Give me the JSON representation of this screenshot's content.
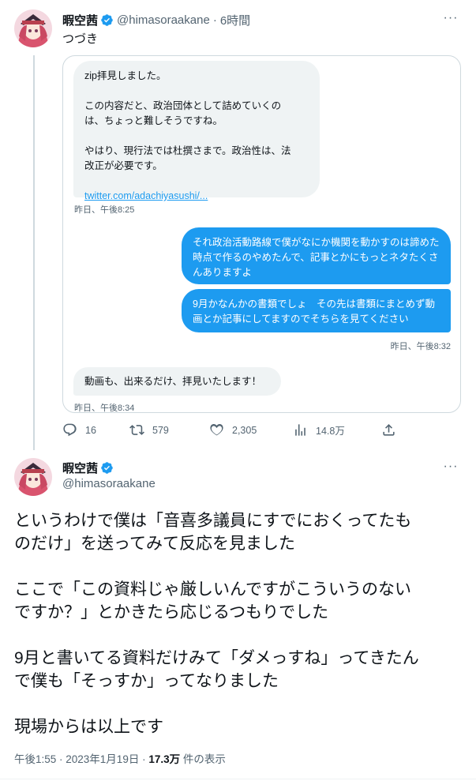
{
  "tweet1": {
    "name": "暇空茜",
    "handle": "@himasoraakane",
    "separator": "·",
    "time": "6時間",
    "text": "つづき",
    "more": "···",
    "dm": {
      "msg1_lines": [
        "zip拝見しました。",
        "",
        "この内容だと、政治団体として詰めていくの",
        "は、ちょっと難しそうですね。",
        "",
        "やはり、現行法では杜撰さまで。政治性は、法",
        "改正が必要です。",
        ""
      ],
      "msg1_link": "twitter.com/adachiyasushi/...",
      "ts1": "昨日、午後8:25",
      "msg2": "それ政治活動路線で僕がなにか機関を動かすのは諦めた時点で作るのやめたんで、記事とかにもっとネタたくさんありますよ",
      "msg3": "9月かなんかの書類でしょ　その先は書類にまとめず動画とか記事にしてますのでそちらを見てください",
      "ts2": "昨日、午後8:32",
      "msg4": "動画も、出来るだけ、拝見いたします！",
      "ts3": "昨日、午後8:34"
    },
    "actions": {
      "replies": "16",
      "retweets": "579",
      "likes": "2,305",
      "views": "14.8万"
    }
  },
  "tweet2": {
    "name": "暇空茜",
    "handle": "@himasoraakane",
    "more": "···",
    "body": [
      "というわけで僕は「音喜多議員にすでにおくってたも",
      "のだけ」を送ってみて反応を見ました",
      "",
      "ここで「この資料じゃ厳しいんですがこういうのない",
      "ですか？」とかきたら応じるつもりでした",
      "",
      "9月と書いてる資料だけみて「ダメっすね」ってきたん",
      "で僕も「そっすか」ってなりました",
      "",
      "現場からは以上です"
    ],
    "time": "午後1:55 · 2023年1月19日 · ",
    "views_count": "17.3万",
    "views_label": " 件の表示"
  },
  "colors": {
    "accent": "#1d9bf0",
    "muted": "#536471",
    "bubble": "#eff3f4"
  },
  "icons": [
    "verified-badge-icon",
    "more-icon",
    "reply-icon",
    "retweet-icon",
    "like-icon",
    "views-icon",
    "share-icon"
  ]
}
